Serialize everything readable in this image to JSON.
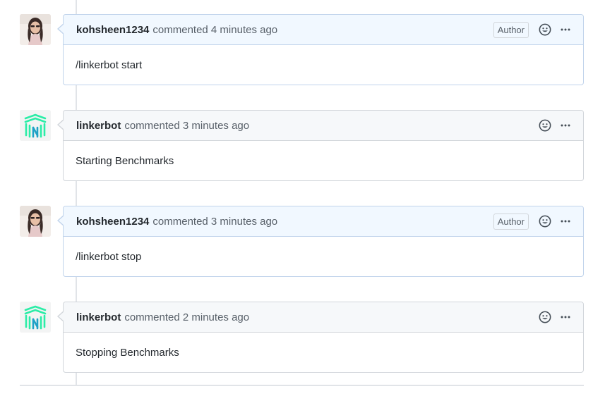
{
  "comments": [
    {
      "author": "kohsheen1234",
      "meta": "commented 4 minutes ago",
      "badge": "Author",
      "body": "/linkerbot start",
      "avatar": "portrait-photo-avatar",
      "own": true
    },
    {
      "author": "linkerbot",
      "meta": "commented 3 minutes ago",
      "badge": "",
      "body": "Starting Benchmarks",
      "avatar": "linkerd-logo-avatar",
      "own": false
    },
    {
      "author": "kohsheen1234",
      "meta": "commented 3 minutes ago",
      "badge": "Author",
      "body": "/linkerbot stop",
      "avatar": "portrait-photo-avatar",
      "own": true
    },
    {
      "author": "linkerbot",
      "meta": "commented 2 minutes ago",
      "badge": "",
      "body": "Stopping Benchmarks",
      "avatar": "linkerd-logo-avatar",
      "own": false
    }
  ],
  "icons": {
    "reaction": "smiley-icon",
    "more": "kebab-horizontal-icon"
  },
  "colors": {
    "own_header_bg": "#f1f8ff",
    "own_border": "#c0d3eb",
    "header_bg": "#f6f8fa",
    "border": "#d1d5da",
    "bot_logo": "#2beda7"
  }
}
